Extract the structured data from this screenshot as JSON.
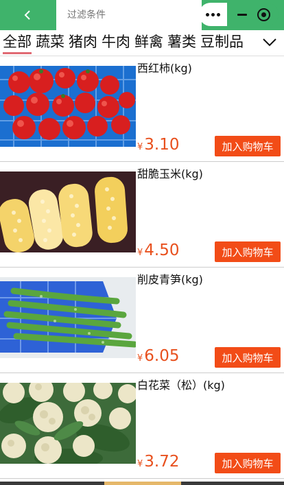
{
  "header": {
    "search_placeholder": "过滤条件",
    "back_icon": "chevron-left-icon",
    "menu_icon": "more-dots-icon",
    "minimize_icon": "minimize-icon",
    "close_icon": "record-circle-icon",
    "bar_color": "#3fb36b"
  },
  "tabs": {
    "items": [
      "全部",
      "蔬菜",
      "猪肉",
      "牛肉",
      "鲜禽",
      "薯类",
      "豆制品"
    ],
    "active_index": 0,
    "expand_icon": "chevron-down-icon"
  },
  "products": [
    {
      "name": "西红柿(kg)",
      "currency": "¥",
      "price": "3.10",
      "button": "加入购物车"
    },
    {
      "name": "甜脆玉米(kg)",
      "currency": "¥",
      "price": "4.50",
      "button": "加入购物车"
    },
    {
      "name": "削皮青笋(kg)",
      "currency": "¥",
      "price": "6.05",
      "button": "加入购物车"
    },
    {
      "name": "白花菜（松）(kg)",
      "currency": "¥",
      "price": "3.72",
      "button": "加入购物车"
    }
  ],
  "colors": {
    "accent": "#f24c17",
    "price": "#e8501d",
    "tab_underline": "#e06a73"
  }
}
